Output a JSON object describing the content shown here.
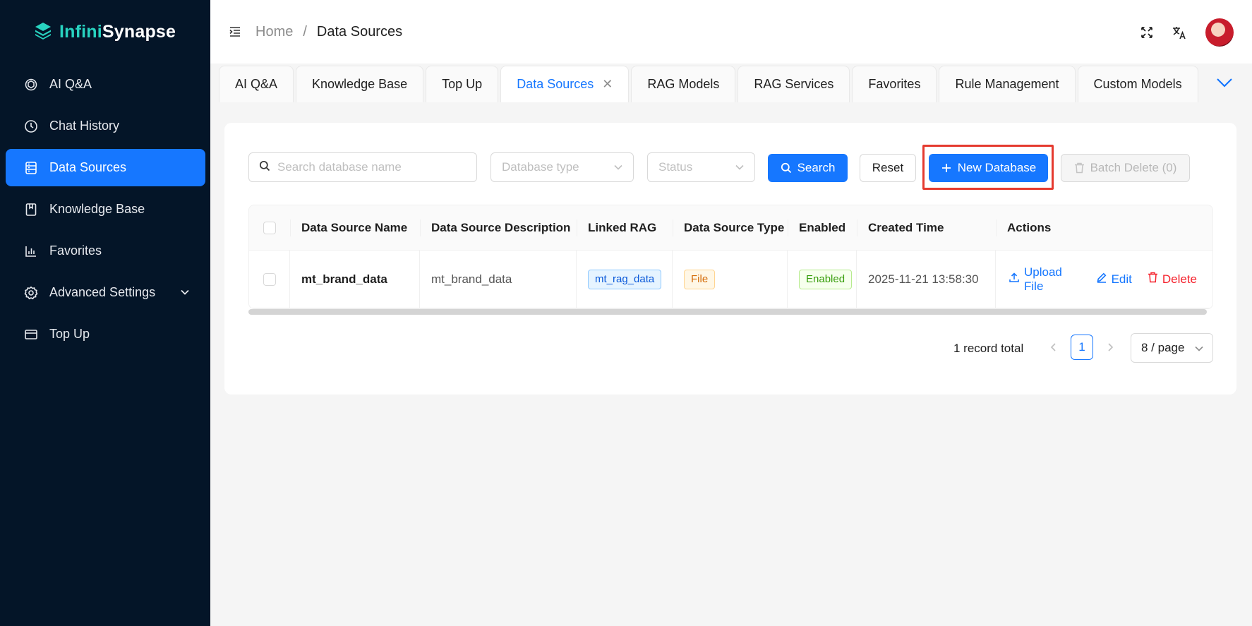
{
  "app": {
    "logo_prefix": "Infini",
    "logo_suffix": "Synapse"
  },
  "sidebar": {
    "items": [
      {
        "label": "AI Q&A",
        "icon": "openai-icon"
      },
      {
        "label": "Chat History",
        "icon": "clock-icon"
      },
      {
        "label": "Data Sources",
        "icon": "database-icon",
        "active": true
      },
      {
        "label": "Knowledge Base",
        "icon": "book-icon"
      },
      {
        "label": "Favorites",
        "icon": "bar-chart-icon"
      },
      {
        "label": "Advanced Settings",
        "icon": "gear-icon",
        "expandable": true
      },
      {
        "label": "Top Up",
        "icon": "wallet-icon"
      }
    ]
  },
  "header": {
    "breadcrumb": {
      "home": "Home",
      "separator": "/",
      "current": "Data Sources"
    }
  },
  "tabs": [
    {
      "label": "AI Q&A"
    },
    {
      "label": "Knowledge Base"
    },
    {
      "label": "Top Up"
    },
    {
      "label": "Data Sources",
      "active": true,
      "closable": true
    },
    {
      "label": "RAG Models"
    },
    {
      "label": "RAG Services"
    },
    {
      "label": "Favorites"
    },
    {
      "label": "Rule Management"
    },
    {
      "label": "Custom Models"
    }
  ],
  "filters": {
    "search_placeholder": "Search database name",
    "type_placeholder": "Database type",
    "status_placeholder": "Status",
    "search_button": "Search",
    "reset_button": "Reset",
    "new_button": "New Database",
    "batch_delete_button": "Batch Delete (0)"
  },
  "table": {
    "columns": [
      "Data Source Name",
      "Data Source Description",
      "Linked RAG",
      "Data Source Type",
      "Enabled",
      "Created Time",
      "Actions"
    ],
    "rows": [
      {
        "name": "mt_brand_data",
        "description": "mt_brand_data",
        "linked_rag": "mt_rag_data",
        "type": "File",
        "enabled": "Enabled",
        "created": "2025-11-21 13:58:30",
        "actions": {
          "upload": "Upload File",
          "edit": "Edit",
          "delete": "Delete"
        }
      }
    ]
  },
  "pagination": {
    "total": "1 record total",
    "current_page": "1",
    "page_size": "8 / page"
  },
  "colors": {
    "primary": "#1677ff",
    "sidebar_bg": "#041528",
    "danger": "#f5222d",
    "highlight": "#e53a2f"
  }
}
